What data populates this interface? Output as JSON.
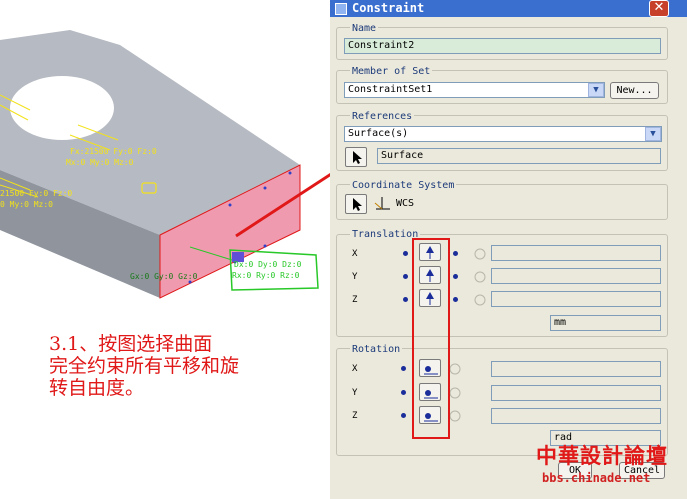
{
  "viewport": {
    "labels_yellow": [
      "Fx:21500 Fy:0 Fz:0",
      "Mx:0 My:0 Mz:0",
      "21500 Fy:0 Fz:0",
      "0 My:0 Mz:0"
    ],
    "labels_green": [
      "Gx:0 Gy:0 Gz:0",
      "Dx:0 Dy:0 Dz:0",
      "Rx:0 Ry:0 Rz:0"
    ],
    "colors": {
      "model": "#aeb2ba",
      "constraint_surface": "#f09ab0",
      "load": "#f2e21a",
      "constraint": "#28c828",
      "arrow": "#e01818"
    }
  },
  "annotation": {
    "lines": [
      "3.1、按图选择曲面",
      "完全约束所有平移和旋",
      "转自由度。"
    ]
  },
  "dialog": {
    "title": "Constraint",
    "close_glyph": "✕",
    "name": {
      "label": "Name",
      "value": "Constraint2"
    },
    "member_of_set": {
      "label": "Member of Set",
      "value": "ConstraintSet1",
      "new_label": "New..."
    },
    "references": {
      "label": "References",
      "type_value": "Surface(s)",
      "selected": "Surface"
    },
    "coordinate_system": {
      "label": "Coordinate System",
      "value": "WCS"
    },
    "translation": {
      "label": "Translation",
      "axes": [
        "X",
        "Y",
        "Z"
      ],
      "units": "mm"
    },
    "rotation": {
      "label": "Rotation",
      "axes": [
        "X",
        "Y",
        "Z"
      ],
      "units": "rad"
    },
    "ok_label": "OK",
    "cancel_label": "Cancel",
    "accent_color": "#3a6fd0"
  },
  "watermark": {
    "text": "中華設計論壇",
    "url": "bbs.chinade.net"
  }
}
